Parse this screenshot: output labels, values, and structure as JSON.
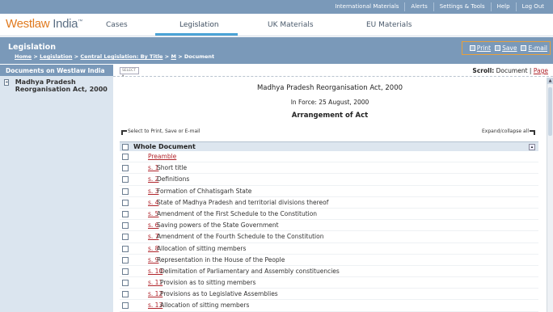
{
  "top_links": [
    "International Materials",
    "Alerts",
    "Settings & Tools",
    "Help",
    "Log Out"
  ],
  "logo": {
    "brand": "Westlaw",
    "region": "India",
    "tm": "™"
  },
  "nav": {
    "tabs": [
      "Cases",
      "Legislation",
      "UK Materials",
      "EU Materials"
    ],
    "active": "Legislation"
  },
  "header": {
    "title": "Legislation",
    "breadcrumb": [
      "Home",
      "Legislation",
      "Central Legislation: By Title",
      "M",
      "Document"
    ],
    "sep": ">",
    "actions": [
      "Print",
      "Save",
      "E-mail"
    ]
  },
  "left_panel": {
    "heading": "Documents on Westlaw India",
    "item": "Madhya Pradesh Reorganisation Act, 2000"
  },
  "toolbar": {
    "select_value": "SELECT",
    "scroll_label": "Scroll:",
    "scroll_document": "Document",
    "scroll_sep": "|",
    "scroll_page": "Page"
  },
  "document": {
    "title": "Madhya Pradesh Reorganisation Act, 2000",
    "in_force": "In Force: 25 August, 2000",
    "arrangement": "Arrangement of Act",
    "select_hint": "Select to Print, Save or E-mail",
    "expand_hint": "Expand/collapse all",
    "whole_document": "Whole Document",
    "preamble": "Preamble",
    "sections": [
      {
        "num": "s. 1",
        "title": "Short title"
      },
      {
        "num": "s. 2",
        "title": "Definitions"
      },
      {
        "num": "s. 3",
        "title": "Formation of Chhatisgarh State"
      },
      {
        "num": "s. 4",
        "title": "State of Madhya Pradesh and territorial divisions thereof"
      },
      {
        "num": "s. 5",
        "title": "Amendment of the First Schedule to the Constitution"
      },
      {
        "num": "s. 6",
        "title": "Saving powers of the State Government"
      },
      {
        "num": "s. 7",
        "title": "Amendment of the Fourth Schedule to the Constitution"
      },
      {
        "num": "s. 8",
        "title": "Allocation of sitting members"
      },
      {
        "num": "s. 9",
        "title": "Representation in the House of the People"
      },
      {
        "num": "s. 10",
        "title": "Delimitation of Parliamentary and Assembly constituencies"
      },
      {
        "num": "s. 11",
        "title": "Provision as to sitting members"
      },
      {
        "num": "s. 12",
        "title": "Provisions as to Legislative Assemblies"
      },
      {
        "num": "s. 13",
        "title": "Allocation of sitting members"
      }
    ]
  },
  "colors": {
    "header_blue": "#7a99b9",
    "accent_orange": "#e07a1f",
    "link_red": "#b0232a",
    "tab_underline": "#4ba3d6"
  }
}
